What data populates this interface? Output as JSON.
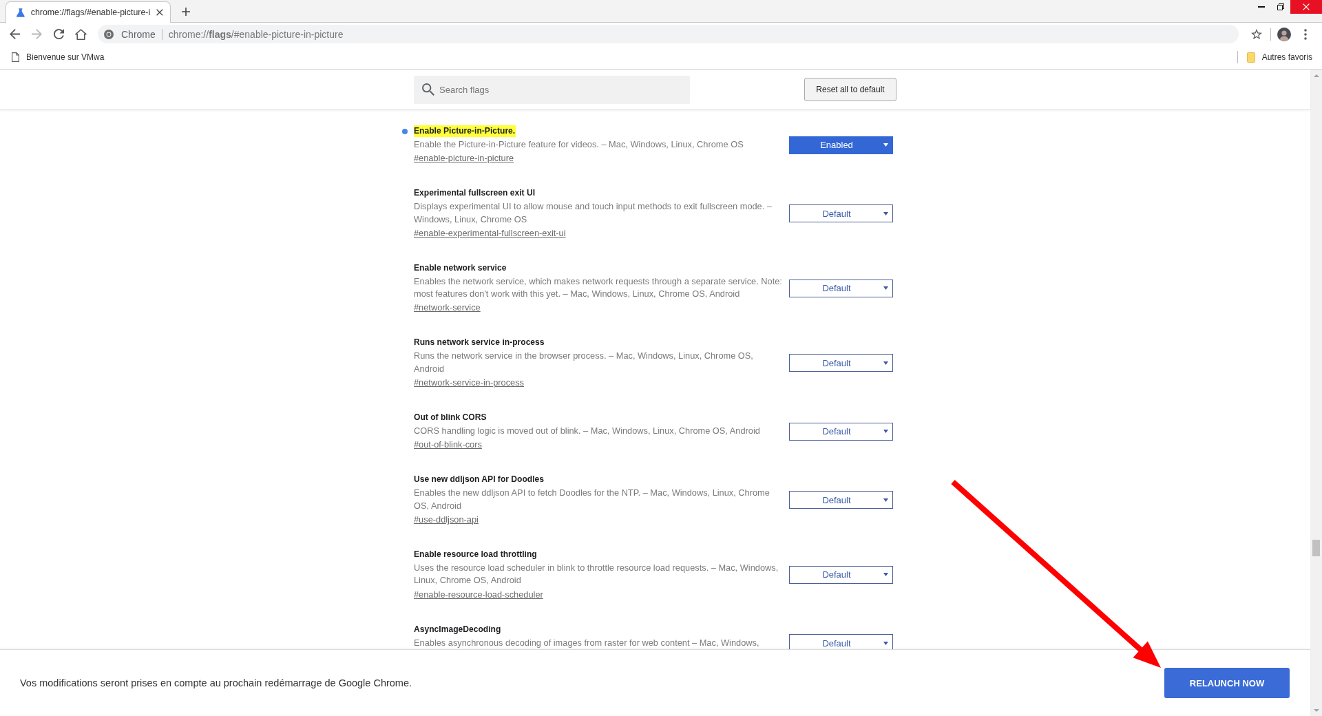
{
  "tabs": [
    {
      "title": "chrome://flags/#enable-picture-i",
      "selected": true
    }
  ],
  "toolbar": {
    "forward_disabled": true,
    "site_label": "Chrome",
    "url": "chrome://**flags**/#enable-picture-in-picture"
  },
  "bookmarks_bar": {
    "items": [
      {
        "title": "Bienvenue sur VMwa"
      }
    ],
    "other_bookmarks": "Autres favoris"
  },
  "search": {
    "placeholder": "Search flags"
  },
  "reset_button": "Reset all to default",
  "flags": [
    {
      "title": "Enable Picture-in-Picture.",
      "highlighted": true,
      "modified": true,
      "description": "Enable the Picture-in-Picture feature for videos. – Mac, Windows, Linux, Chrome OS",
      "link": "#enable-picture-in-picture",
      "value": "Enabled"
    },
    {
      "title": "Experimental fullscreen exit UI",
      "highlighted": false,
      "modified": false,
      "description": "Displays experimental UI to allow mouse and touch input methods to exit fullscreen mode. – Windows, Linux, Chrome OS",
      "link": "#enable-experimental-fullscreen-exit-ui",
      "value": "Default"
    },
    {
      "title": "Enable network service",
      "highlighted": false,
      "modified": false,
      "description": "Enables the network service, which makes network requests through a separate service. Note: most features don't work with this yet. – Mac, Windows, Linux, Chrome OS, Android",
      "link": "#network-service",
      "value": "Default"
    },
    {
      "title": "Runs network service in-process",
      "highlighted": false,
      "modified": false,
      "description": "Runs the network service in the browser process. – Mac, Windows, Linux, Chrome OS, Android",
      "link": "#network-service-in-process",
      "value": "Default"
    },
    {
      "title": "Out of blink CORS",
      "highlighted": false,
      "modified": false,
      "description": "CORS handling logic is moved out of blink. – Mac, Windows, Linux, Chrome OS, Android",
      "link": "#out-of-blink-cors",
      "value": "Default"
    },
    {
      "title": "Use new ddljson API for Doodles",
      "highlighted": false,
      "modified": false,
      "description": "Enables the new ddljson API to fetch Doodles for the NTP. – Mac, Windows, Linux, Chrome OS, Android",
      "link": "#use-ddljson-api",
      "value": "Default"
    },
    {
      "title": "Enable resource load throttling",
      "highlighted": false,
      "modified": false,
      "description": "Uses the resource load scheduler in blink to throttle resource load requests. – Mac, Windows, Linux, Chrome OS, Android",
      "link": "#enable-resource-load-scheduler",
      "value": "Default"
    },
    {
      "title": "AsyncImageDecoding",
      "highlighted": false,
      "modified": false,
      "description": "Enables asynchronous decoding of images from raster for web content – Mac, Windows,",
      "value": "Default"
    }
  ],
  "relaunch_bar": {
    "message": "Vos modifications seront prises en compte au prochain redémarrage de Google Chrome.",
    "button": "RELAUNCH NOW"
  }
}
